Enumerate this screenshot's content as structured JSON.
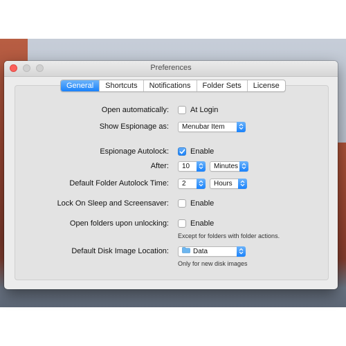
{
  "window": {
    "title": "Preferences"
  },
  "tabs": [
    {
      "label": "General",
      "active": true
    },
    {
      "label": "Shortcuts",
      "active": false
    },
    {
      "label": "Notifications",
      "active": false
    },
    {
      "label": "Folder Sets",
      "active": false
    },
    {
      "label": "License",
      "active": false
    }
  ],
  "form": {
    "open_automatically": {
      "label": "Open automatically:",
      "checkbox_label": "At Login",
      "checked": false
    },
    "show_espionage_as": {
      "label": "Show Espionage as:",
      "value": "Menubar Item"
    },
    "autolock": {
      "label": "Espionage Autolock:",
      "checkbox_label": "Enable",
      "checked": true
    },
    "after": {
      "label": "After:",
      "amount": "10",
      "unit": "Minutes"
    },
    "default_folder_autolock": {
      "label": "Default Folder Autolock Time:",
      "amount": "2",
      "unit": "Hours"
    },
    "lock_on_sleep": {
      "label": "Lock On Sleep and Screensaver:",
      "checkbox_label": "Enable",
      "checked": false
    },
    "open_folders_unlocking": {
      "label": "Open folders upon unlocking:",
      "checkbox_label": "Enable",
      "checked": false,
      "hint": "Except for folders with folder actions."
    },
    "disk_image_location": {
      "label": "Default Disk Image Location:",
      "value": "Data",
      "hint": "Only for new disk images"
    }
  },
  "colors": {
    "accent": "#1a82fb",
    "close": "#fc605c",
    "window_bg": "#ececec"
  },
  "icons": {
    "checkmark": "checkmark-icon",
    "stepper": "updown-chevron-icon",
    "folder": "folder-icon"
  }
}
